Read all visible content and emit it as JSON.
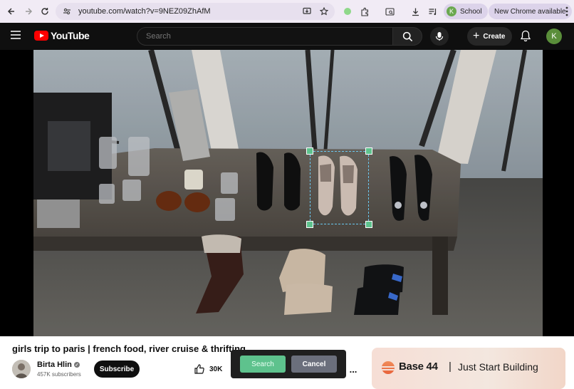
{
  "browser": {
    "url": "youtube.com/watch?v=9NEZ09ZhAfM",
    "profile_initial": "K",
    "profile_label": "School",
    "update_label": "New Chrome available"
  },
  "youtube": {
    "logo_text": "YouTube",
    "search_placeholder": "Search",
    "create_label": "Create",
    "user_initial": "K"
  },
  "video": {
    "title": "girls trip to paris | french food, river cruise & thrifting",
    "channel_name": "Birta Hlin",
    "subscribers": "457K subscribers",
    "subscribe_label": "Subscribe",
    "likes": "30K",
    "more_label": "..."
  },
  "ad": {
    "brand": "Base 44",
    "separator": "|",
    "tagline": "Just Start Building"
  },
  "selection_tool": {
    "search_label": "Search",
    "cancel_label": "Cancel",
    "accent": "#5ec28d"
  }
}
